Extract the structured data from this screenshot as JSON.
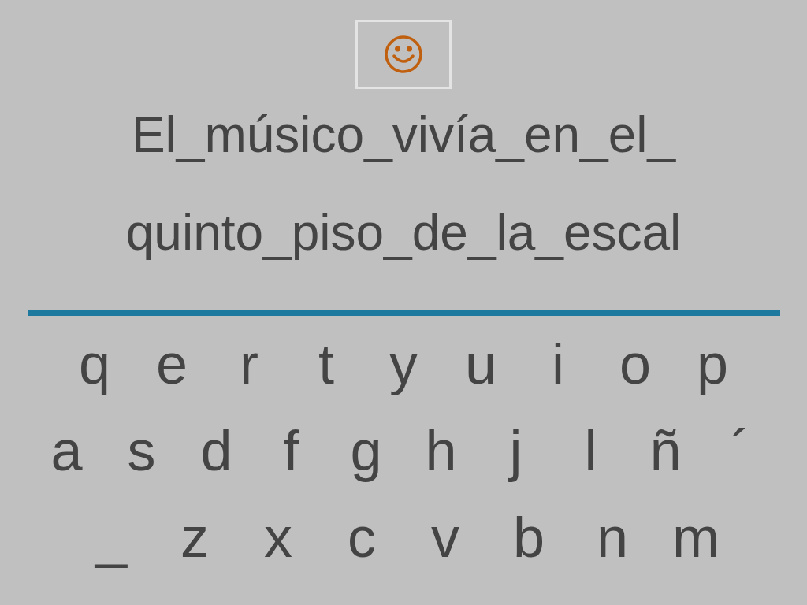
{
  "sentence_lines": [
    "El_músico_vivía_en_el_",
    "quinto_piso_de_la_escal"
  ],
  "keyboard": {
    "rows": [
      [
        "q",
        "e",
        "r",
        "t",
        "y",
        "u",
        "i",
        "o",
        "p"
      ],
      [
        "a",
        "s",
        "d",
        "f",
        "g",
        "h",
        "j",
        "l",
        "ñ",
        "´"
      ],
      [
        "_",
        "z",
        "x",
        "c",
        "v",
        "b",
        "n",
        "m"
      ]
    ]
  }
}
